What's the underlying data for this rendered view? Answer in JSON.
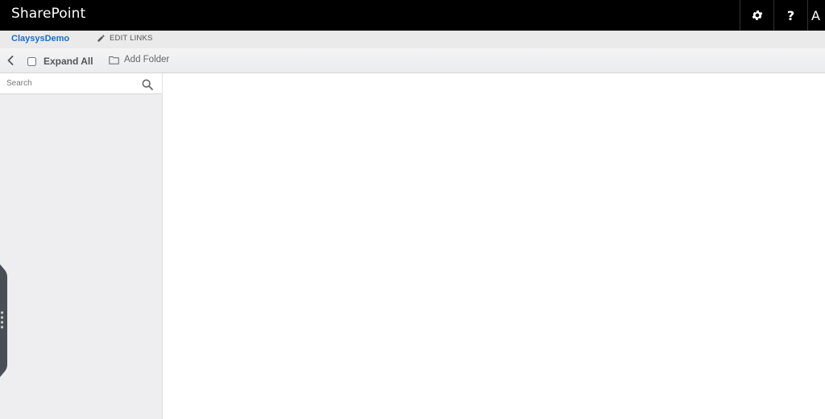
{
  "suitebar": {
    "brand": "SharePoint",
    "settings_icon": "gear-icon",
    "help_label": "?",
    "user_initial": "A"
  },
  "nav": {
    "site_title": "ClaysysDemo",
    "edit_links_label": "EDIT LINKS",
    "edit_icon": "pencil-icon"
  },
  "toolbar": {
    "back_icon": "chevron-left-icon",
    "expand_all_label": "Expand All",
    "expand_all_checked": false,
    "add_folder_label": "Add Folder",
    "folder_icon": "folder-icon"
  },
  "left_panel": {
    "search": {
      "placeholder": "Search",
      "value": ""
    },
    "handle_icon": "drag-handle-icon"
  },
  "colors": {
    "suitebar_bg": "#000000",
    "accent_link": "#1a6fc4",
    "panel_bg": "#eeeef0",
    "handle_bg": "#4a4f57"
  }
}
